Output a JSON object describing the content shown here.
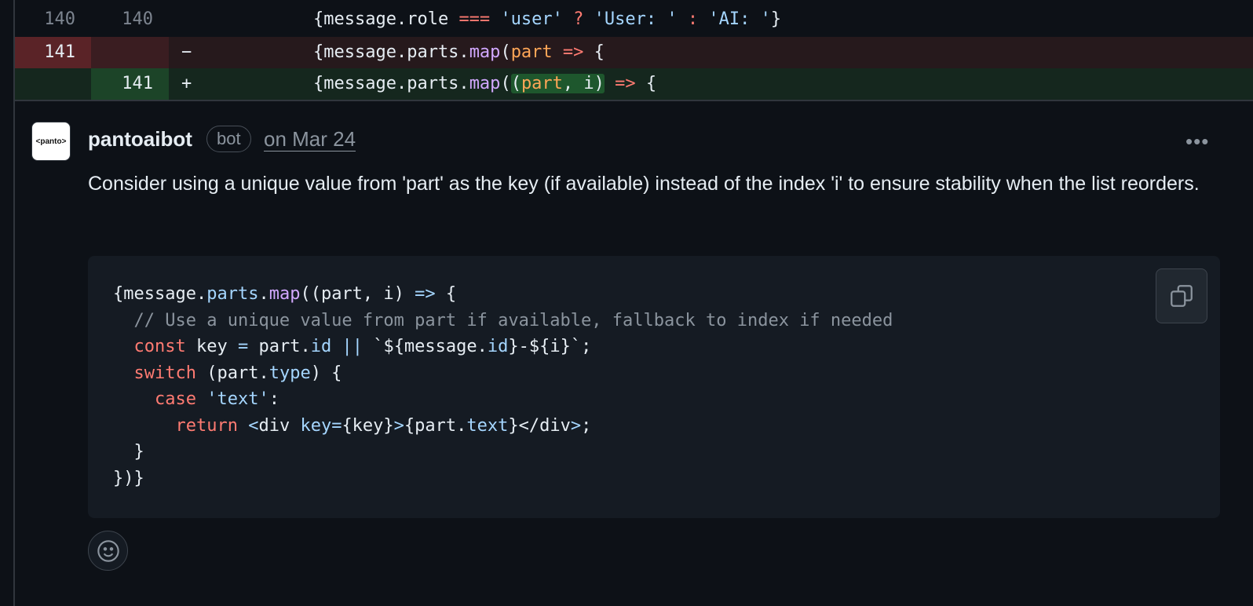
{
  "diff": {
    "context_row": {
      "old_line": "140",
      "new_line": "140"
    },
    "deleted_row": {
      "old_line": "141",
      "new_line": "",
      "marker": "−"
    },
    "added_row": {
      "old_line": "",
      "new_line": "141",
      "marker": "+"
    }
  },
  "comment": {
    "author": "pantoaibot",
    "avatar_text": "<panto>",
    "badge": "bot",
    "date": "on Mar 24",
    "more_menu": "•••",
    "body": "Consider using a unique value from 'part' as the key (if available) instead of the index 'i' to ensure stability when the list reorders."
  },
  "colors": {
    "background": "#0d1117",
    "deleted_line_number_bg": "#5a2327",
    "added_line_number_bg": "#1c4428",
    "keyword": "#ff7b72",
    "string": "#a5d6ff",
    "function": "#d2a8ff",
    "param": "#ffa657"
  },
  "icons": {
    "copy": "copy-icon",
    "reaction": "smiley-icon",
    "more": "kebab-horizontal-icon"
  }
}
